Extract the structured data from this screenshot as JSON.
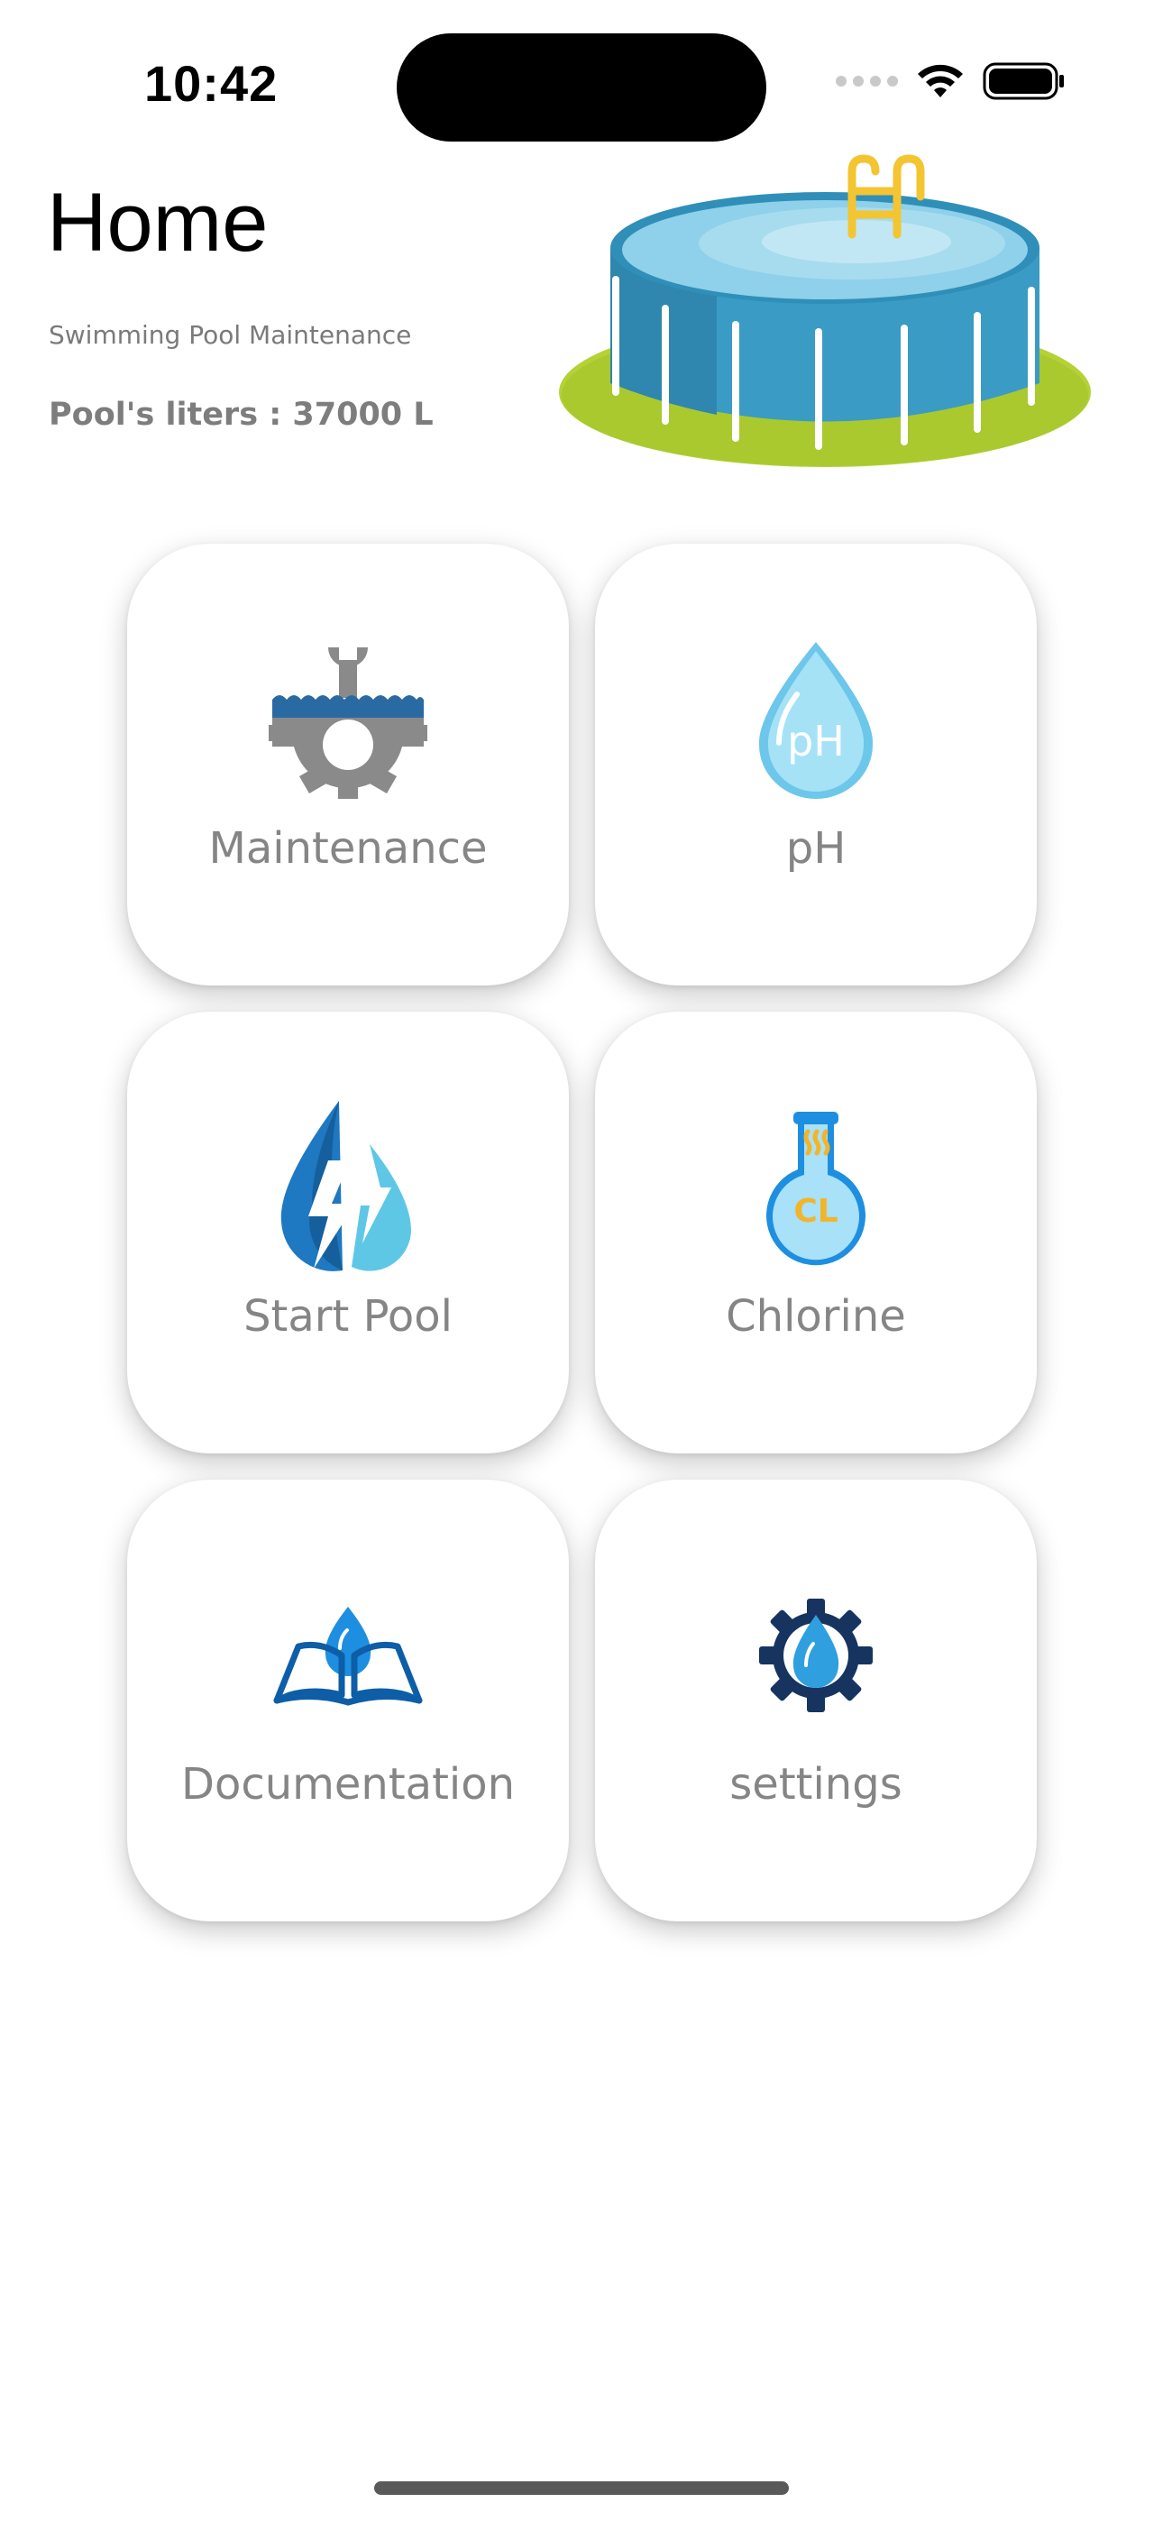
{
  "status_bar": {
    "time": "10:42"
  },
  "header": {
    "title": "Home",
    "subtitle": "Swimming Pool Maintenance",
    "pool_liters": "Pool's liters : 37000 L"
  },
  "grid": {
    "items": [
      {
        "label": "Maintenance",
        "icon": "maintenance-gear-wrench-icon"
      },
      {
        "label": "pH",
        "icon": "ph-water-drop-icon",
        "icon_text": "pH"
      },
      {
        "label": "Start Pool",
        "icon": "lightning-water-drop-icon"
      },
      {
        "label": "Chlorine",
        "icon": "chlorine-flask-icon",
        "icon_text": "CL"
      },
      {
        "label": "Documentation",
        "icon": "book-water-drop-icon"
      },
      {
        "label": "settings",
        "icon": "gear-water-drop-icon"
      }
    ]
  },
  "colors": {
    "pool_blue": "#3a9bc4",
    "grass_green": "#b4d236",
    "ladder_yellow": "#f3c531",
    "ph_drop": "#7fd3ef",
    "maintenance_gray": "#8a8a8a",
    "maintenance_blue": "#2a6aa3",
    "start_blue": "#1e78c2",
    "start_light": "#5fc7e6",
    "chlorine_blue": "#1e8fe0",
    "chlorine_yellow": "#f2b52a",
    "doc_blue": "#0d5ea7",
    "settings_navy": "#16345f",
    "settings_drop": "#2f9fe0"
  }
}
